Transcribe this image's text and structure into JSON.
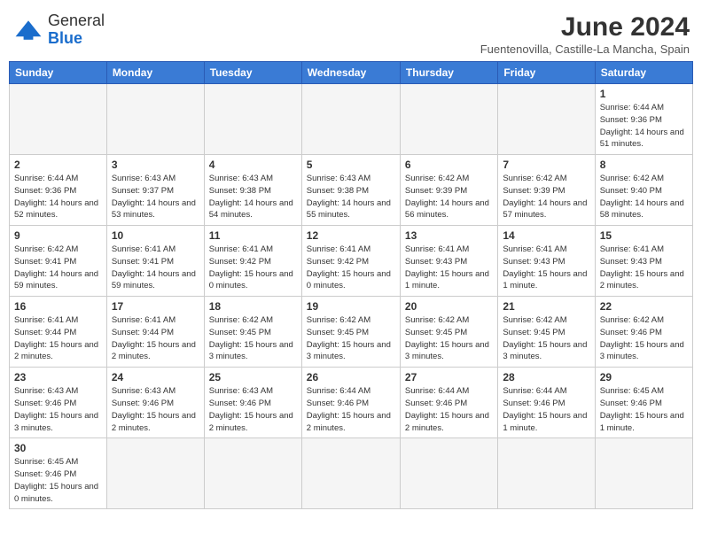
{
  "header": {
    "logo_line1": "General",
    "logo_line2": "Blue",
    "title": "June 2024",
    "subtitle": "Fuentenovilla, Castille-La Mancha, Spain"
  },
  "weekdays": [
    "Sunday",
    "Monday",
    "Tuesday",
    "Wednesday",
    "Thursday",
    "Friday",
    "Saturday"
  ],
  "weeks": [
    [
      {
        "day": "",
        "info": ""
      },
      {
        "day": "",
        "info": ""
      },
      {
        "day": "",
        "info": ""
      },
      {
        "day": "",
        "info": ""
      },
      {
        "day": "",
        "info": ""
      },
      {
        "day": "",
        "info": ""
      },
      {
        "day": "1",
        "info": "Sunrise: 6:44 AM\nSunset: 9:36 PM\nDaylight: 14 hours\nand 51 minutes."
      }
    ],
    [
      {
        "day": "2",
        "info": "Sunrise: 6:44 AM\nSunset: 9:36 PM\nDaylight: 14 hours\nand 52 minutes."
      },
      {
        "day": "3",
        "info": "Sunrise: 6:43 AM\nSunset: 9:37 PM\nDaylight: 14 hours\nand 53 minutes."
      },
      {
        "day": "4",
        "info": "Sunrise: 6:43 AM\nSunset: 9:38 PM\nDaylight: 14 hours\nand 54 minutes."
      },
      {
        "day": "5",
        "info": "Sunrise: 6:43 AM\nSunset: 9:38 PM\nDaylight: 14 hours\nand 55 minutes."
      },
      {
        "day": "6",
        "info": "Sunrise: 6:42 AM\nSunset: 9:39 PM\nDaylight: 14 hours\nand 56 minutes."
      },
      {
        "day": "7",
        "info": "Sunrise: 6:42 AM\nSunset: 9:39 PM\nDaylight: 14 hours\nand 57 minutes."
      },
      {
        "day": "8",
        "info": "Sunrise: 6:42 AM\nSunset: 9:40 PM\nDaylight: 14 hours\nand 58 minutes."
      }
    ],
    [
      {
        "day": "9",
        "info": "Sunrise: 6:42 AM\nSunset: 9:41 PM\nDaylight: 14 hours\nand 59 minutes."
      },
      {
        "day": "10",
        "info": "Sunrise: 6:41 AM\nSunset: 9:41 PM\nDaylight: 14 hours\nand 59 minutes."
      },
      {
        "day": "11",
        "info": "Sunrise: 6:41 AM\nSunset: 9:42 PM\nDaylight: 15 hours\nand 0 minutes."
      },
      {
        "day": "12",
        "info": "Sunrise: 6:41 AM\nSunset: 9:42 PM\nDaylight: 15 hours\nand 0 minutes."
      },
      {
        "day": "13",
        "info": "Sunrise: 6:41 AM\nSunset: 9:43 PM\nDaylight: 15 hours\nand 1 minute."
      },
      {
        "day": "14",
        "info": "Sunrise: 6:41 AM\nSunset: 9:43 PM\nDaylight: 15 hours\nand 1 minute."
      },
      {
        "day": "15",
        "info": "Sunrise: 6:41 AM\nSunset: 9:43 PM\nDaylight: 15 hours\nand 2 minutes."
      }
    ],
    [
      {
        "day": "16",
        "info": "Sunrise: 6:41 AM\nSunset: 9:44 PM\nDaylight: 15 hours\nand 2 minutes."
      },
      {
        "day": "17",
        "info": "Sunrise: 6:41 AM\nSunset: 9:44 PM\nDaylight: 15 hours\nand 2 minutes."
      },
      {
        "day": "18",
        "info": "Sunrise: 6:42 AM\nSunset: 9:45 PM\nDaylight: 15 hours\nand 3 minutes."
      },
      {
        "day": "19",
        "info": "Sunrise: 6:42 AM\nSunset: 9:45 PM\nDaylight: 15 hours\nand 3 minutes."
      },
      {
        "day": "20",
        "info": "Sunrise: 6:42 AM\nSunset: 9:45 PM\nDaylight: 15 hours\nand 3 minutes."
      },
      {
        "day": "21",
        "info": "Sunrise: 6:42 AM\nSunset: 9:45 PM\nDaylight: 15 hours\nand 3 minutes."
      },
      {
        "day": "22",
        "info": "Sunrise: 6:42 AM\nSunset: 9:46 PM\nDaylight: 15 hours\nand 3 minutes."
      }
    ],
    [
      {
        "day": "23",
        "info": "Sunrise: 6:43 AM\nSunset: 9:46 PM\nDaylight: 15 hours\nand 3 minutes."
      },
      {
        "day": "24",
        "info": "Sunrise: 6:43 AM\nSunset: 9:46 PM\nDaylight: 15 hours\nand 2 minutes."
      },
      {
        "day": "25",
        "info": "Sunrise: 6:43 AM\nSunset: 9:46 PM\nDaylight: 15 hours\nand 2 minutes."
      },
      {
        "day": "26",
        "info": "Sunrise: 6:44 AM\nSunset: 9:46 PM\nDaylight: 15 hours\nand 2 minutes."
      },
      {
        "day": "27",
        "info": "Sunrise: 6:44 AM\nSunset: 9:46 PM\nDaylight: 15 hours\nand 2 minutes."
      },
      {
        "day": "28",
        "info": "Sunrise: 6:44 AM\nSunset: 9:46 PM\nDaylight: 15 hours\nand 1 minute."
      },
      {
        "day": "29",
        "info": "Sunrise: 6:45 AM\nSunset: 9:46 PM\nDaylight: 15 hours\nand 1 minute."
      }
    ],
    [
      {
        "day": "30",
        "info": "Sunrise: 6:45 AM\nSunset: 9:46 PM\nDaylight: 15 hours\nand 0 minutes."
      },
      {
        "day": "",
        "info": ""
      },
      {
        "day": "",
        "info": ""
      },
      {
        "day": "",
        "info": ""
      },
      {
        "day": "",
        "info": ""
      },
      {
        "day": "",
        "info": ""
      },
      {
        "day": "",
        "info": ""
      }
    ]
  ]
}
